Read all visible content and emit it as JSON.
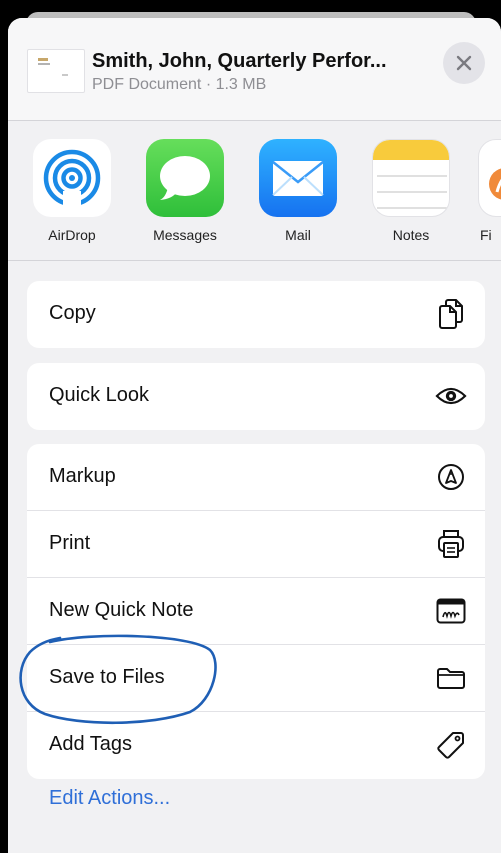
{
  "header": {
    "title": "Smith, John, Quarterly Perfor...",
    "subtitle": "PDF Document · 1.3 MB"
  },
  "apps": [
    {
      "label": "AirDrop",
      "icon": "airdrop-icon"
    },
    {
      "label": "Messages",
      "icon": "messages-icon"
    },
    {
      "label": "Mail",
      "icon": "mail-icon"
    },
    {
      "label": "Notes",
      "icon": "notes-icon"
    },
    {
      "label": "Fi",
      "icon": "freeform-icon"
    }
  ],
  "actions_group1": [
    {
      "label": "Copy",
      "icon": "copy-icon"
    }
  ],
  "actions_group2": [
    {
      "label": "Quick Look",
      "icon": "eye-icon"
    }
  ],
  "actions_group3": [
    {
      "label": "Markup",
      "icon": "markup-icon"
    },
    {
      "label": "Print",
      "icon": "printer-icon"
    },
    {
      "label": "New Quick Note",
      "icon": "quick-note-icon"
    },
    {
      "label": "Save to Files",
      "icon": "folder-icon"
    },
    {
      "label": "Add Tags",
      "icon": "tag-icon"
    }
  ],
  "footer": {
    "edit_actions": "Edit Actions..."
  },
  "colors": {
    "accent": "#2f6fd8",
    "annotation": "#1f5fb5"
  }
}
